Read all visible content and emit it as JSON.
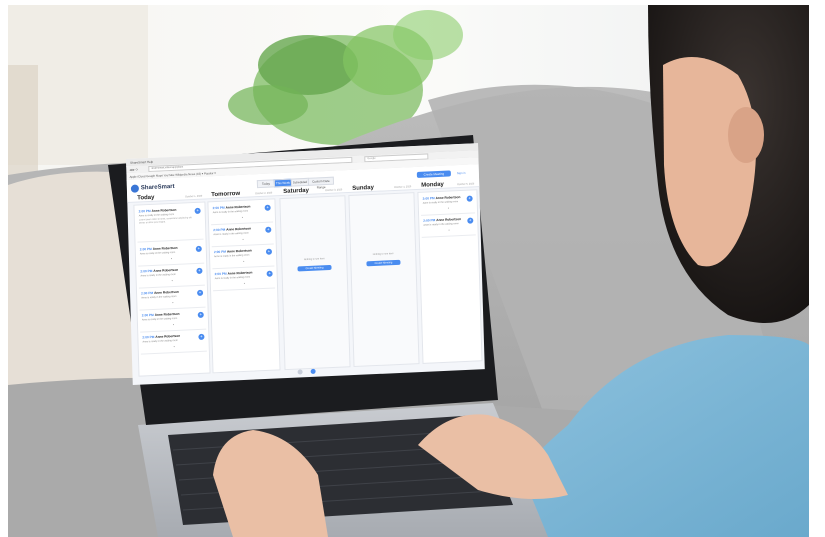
{
  "browser": {
    "tab_title": "ShareSmart Help",
    "url": "sharesmart.video/app/plans",
    "search_placeholder": "Google",
    "bookmarks": "Apple  iCloud  Google Maps  YouTube  Wikipedia  News (18) ▾  Popular ▾"
  },
  "app": {
    "name": "ShareSmart",
    "views": [
      "Today",
      "This Week",
      "Scheduled",
      "Custom Date Range"
    ],
    "create_label": "Create Meeting",
    "header_link": "Sign in"
  },
  "days": [
    {
      "title": "Today",
      "date": "October 1, 2020",
      "cards": [
        {
          "time": "2:00 PM",
          "name": "Anne Robertson",
          "status": "Anne is ready in the waiting room",
          "notes": "Lorem ipsum dolor sit amet, consectetur adipiscing elit. Donec et dolor quis magna."
        },
        {
          "time": "2:00 PM",
          "name": "Anne Robertson",
          "status": "Anne is ready in the waiting room"
        },
        {
          "time": "2:00 PM",
          "name": "Anne Robertson",
          "status": "Anne is ready in the waiting room"
        },
        {
          "time": "2:00 PM",
          "name": "Anne Robertson",
          "status": "Anne is ready in the waiting room"
        },
        {
          "time": "2:00 PM",
          "name": "Anne Robertson",
          "status": "Anne is ready in the waiting room"
        },
        {
          "time": "2:00 PM",
          "name": "Anne Robertson",
          "status": "Anne is ready in the waiting room"
        }
      ]
    },
    {
      "title": "Tomorrow",
      "date": "October 2, 2020",
      "cards": [
        {
          "time": "2:00 PM",
          "name": "Anne Robertson",
          "status": "Anne is ready in the waiting room"
        },
        {
          "time": "2:00 PM",
          "name": "Anne Robertson",
          "status": "Anne is ready in the waiting room"
        },
        {
          "time": "2:00 PM",
          "name": "Anne Robertson",
          "status": "Anne is ready in the waiting room"
        },
        {
          "time": "2:00 PM",
          "name": "Anne Robertson",
          "status": "Anne is ready in the waiting room"
        }
      ]
    },
    {
      "title": "Saturday",
      "date": "October 3, 2020",
      "empty_text": "Nothing to see here",
      "create_label": "Create Meeting"
    },
    {
      "title": "Sunday",
      "date": "October 4, 2020",
      "empty_text": "Nothing to see here",
      "create_label": "Create Meeting"
    },
    {
      "title": "Monday",
      "date": "October 5, 2020",
      "cards": [
        {
          "time": "2:00 PM",
          "name": "Anne Robertson",
          "status": "Anne is ready in the waiting room"
        },
        {
          "time": "2:00 PM",
          "name": "Anne Robertson",
          "status": "Anne is ready in the waiting room"
        }
      ]
    }
  ],
  "colors": {
    "accent": "#4a8cf0",
    "shirt": "#7fb8d8",
    "sofa": "#aaaaaa"
  }
}
